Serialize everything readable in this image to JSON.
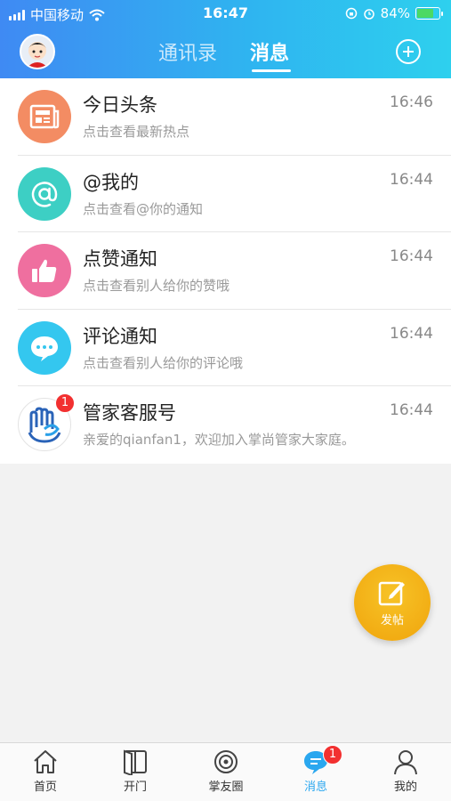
{
  "status_bar": {
    "carrier": "中国移动",
    "time": "16:47",
    "battery": "84%",
    "battery_level": 0.84
  },
  "header": {
    "tabs": [
      "通讯录",
      "消息"
    ],
    "active_tab": "消息"
  },
  "messages": [
    {
      "title": "今日头条",
      "subtitle": "点击查看最新热点",
      "time": "16:46",
      "icon": "newspaper-icon",
      "color": "#f38c63"
    },
    {
      "title": "@我的",
      "subtitle": "点击查看@你的通知",
      "time": "16:44",
      "icon": "at-icon",
      "color": "#3dcfc4"
    },
    {
      "title": "点赞通知",
      "subtitle": "点击查看别人给你的赞哦",
      "time": "16:44",
      "icon": "thumbs-up-icon",
      "color": "#ef6f9f"
    },
    {
      "title": "评论通知",
      "subtitle": "点击查看别人给你的评论哦",
      "time": "16:44",
      "icon": "comment-icon",
      "color": "#34c7ef"
    },
    {
      "title": "管家客服号",
      "subtitle": "亲爱的qianfan1，欢迎加入掌尚管家大家庭。",
      "time": "16:44",
      "icon": "service-logo-icon",
      "color": "#2a8ad6",
      "badge": "1"
    }
  ],
  "fab": {
    "label": "发帖"
  },
  "tabbar": [
    {
      "label": "首页",
      "icon": "home-icon"
    },
    {
      "label": "开门",
      "icon": "door-icon"
    },
    {
      "label": "掌友圈",
      "icon": "circle-icon"
    },
    {
      "label": "消息",
      "icon": "message-icon",
      "badge": "1",
      "active": true
    },
    {
      "label": "我的",
      "icon": "person-icon"
    }
  ]
}
